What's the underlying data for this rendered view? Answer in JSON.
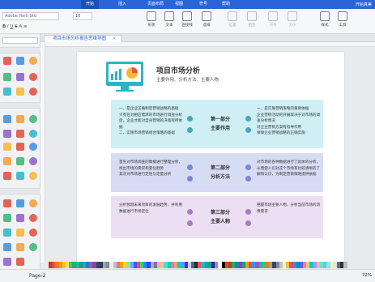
{
  "menu": [
    "开始",
    "插入",
    "页面布局",
    "视图",
    "符号",
    "帮助"
  ],
  "menu_active": 0,
  "user": "开始真美",
  "toolbar": {
    "font_name": "Adobe Heiti Std",
    "font_size": "10",
    "buttons": [
      "形状",
      "文本",
      "连接线",
      "选择",
      "位置",
      "组合",
      "对齐",
      "大小",
      "样式",
      "工具"
    ]
  },
  "tab": {
    "title": "项目市场分析报告思维导图"
  },
  "page": {
    "title": "项目市场分析",
    "subtitle": "主要作用、分析方法、主要人物"
  },
  "sections": [
    {
      "mid": [
        "第一部分",
        "主要作用"
      ],
      "left": "一、是企业正确制定营销战略的基础\n只有在对相应需求的市场进行调查分析后，企业才能对自身营销的决策有所依据\n二、实施市场营销组合策略的基础",
      "right": "一、是实施营销策略的重要依据\n企业营销活动的开展取决于对市场的调查分析情况\n对企业营销方案有指导作用\n保障企业营销战略的正确实施",
      "bg": "#cfeff5",
      "dot": "#4aa8b5"
    },
    {
      "mid": [
        "第二部分",
        "分析方法"
      ],
      "left": "首先对市场调查的数据进行整理分析，找出市场的需求和变化趋势\n其次对市场进行定性与定量分析",
      "right": "对市场的各种数据进行了具体的分析，从而使人们对这个市场有比较清晰的了解和认识，为制定营销策略提供依据",
      "bg": "#d7dcf5",
      "dot": "#7a86d8"
    },
    {
      "mid": [
        "第三部分",
        "主要人物"
      ],
      "left": "分析预测未来项目的发展趋势，并利用数据进行市场定位",
      "right": "把握市场主要人物，分析当前市场的消费需求",
      "bg": "#ecdff3",
      "dot": "#a77bc4"
    }
  ],
  "status": {
    "page": "Page-2",
    "zoom": "72%"
  },
  "palette": [
    "#c0392b",
    "#e74c3c",
    "#e67e22",
    "#f39c12",
    "#f1c40f",
    "#f7dc6f",
    "#2ecc71",
    "#27ae60",
    "#1abc9c",
    "#16a085",
    "#3498db",
    "#2980b9",
    "#9b59b6",
    "#8e44ad",
    "#34495e",
    "#2c3e50",
    "#95a5a6",
    "#7f8c8d",
    "#ecf0f1",
    "#bdc3c7",
    "#ff6b6b",
    "#ffa502",
    "#ffd32a",
    "#7bed9f",
    "#70a1ff",
    "#5352ed",
    "#ff4757",
    "#2ed573",
    "#1e90ff",
    "#3742fa",
    "#a4b0be",
    "#747d8c",
    "#ff9ff3",
    "#feca57",
    "#48dbfb",
    "#1dd1a1",
    "#f368e0",
    "#ff9f43",
    "#00d2d3",
    "#54a0ff",
    "#5f27cd",
    "#c8d6e5",
    "#576574",
    "#222f3e",
    "#ee5253",
    "#0abde3",
    "#10ac84",
    "#01a3a4",
    "#341f97",
    "#8395a7",
    "#ffffff",
    "#000000",
    "#d35400",
    "#c0392b",
    "#27ae60",
    "#2980b9",
    "#8e44ad",
    "#16a085",
    "#f39c12",
    "#e74c3c",
    "#3498db",
    "#9b59b6",
    "#1abc9c",
    "#2ecc71",
    "#e67e22",
    "#95a5a6",
    "#34495e",
    "#7f8c8d",
    "#bdc3c7",
    "#ecf0f1",
    "#f1c40f",
    "#e84393",
    "#00b894",
    "#0984e3",
    "#6c5ce7",
    "#fd79a8",
    "#fdcb6e",
    "#00cec9",
    "#a29bfe",
    "#fab1a0",
    "#55efc4",
    "#74b9ff",
    "#81ecec",
    "#ffeaa7",
    "#dfe6e9",
    "#636e72",
    "#2d3436",
    "#b2bec3"
  ]
}
